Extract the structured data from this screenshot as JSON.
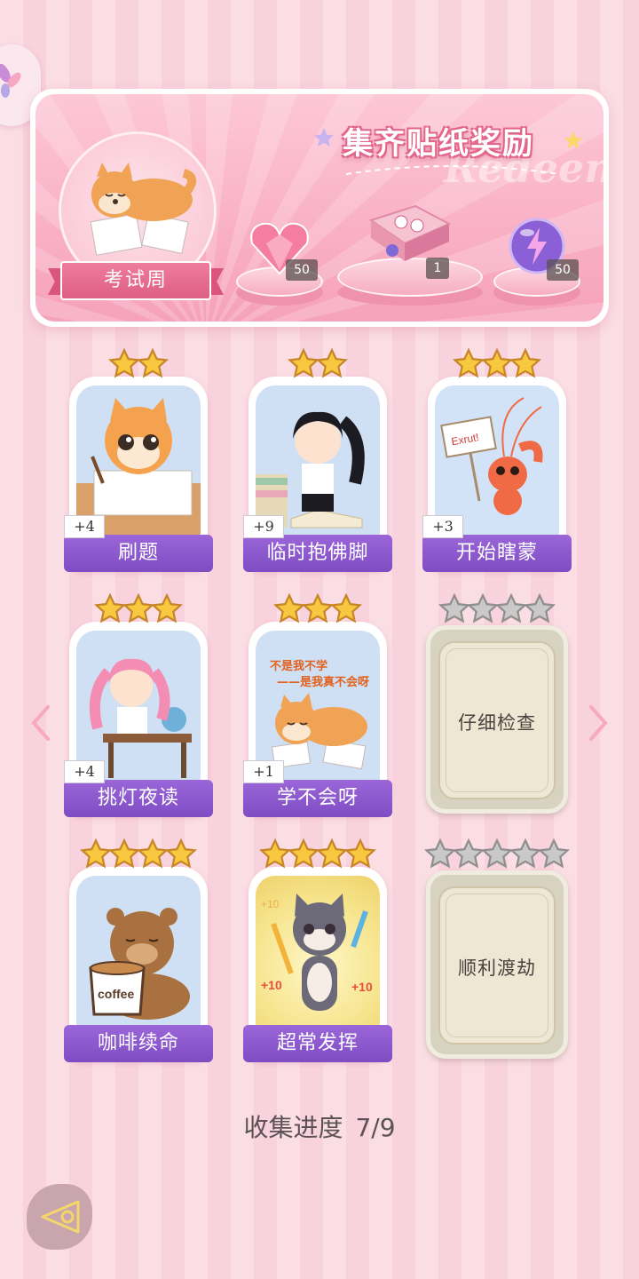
{
  "banner": {
    "title": "集齐贴纸奖励",
    "watermark": "Redeem",
    "theme_label": "考试周",
    "rewards": [
      {
        "name": "pink-heart-gem",
        "count": "50"
      },
      {
        "name": "stationery-gift-box",
        "count": "1"
      },
      {
        "name": "purple-energy-orb",
        "count": "50"
      }
    ]
  },
  "stickers": [
    {
      "label": "刷题",
      "stars": 2,
      "bonus": "+4",
      "collected": true,
      "art": "cat-writing-icon"
    },
    {
      "label": "临时抱佛脚",
      "stars": 2,
      "bonus": "+9",
      "collected": true,
      "art": "girl-reading-icon"
    },
    {
      "label": "开始瞎蒙",
      "stars": 3,
      "bonus": "+3",
      "collected": true,
      "art": "lobster-sign-icon",
      "sign_text": "Exrut!"
    },
    {
      "label": "挑灯夜读",
      "stars": 3,
      "bonus": "+4",
      "collected": true,
      "art": "pink-girl-desk-icon"
    },
    {
      "label": "学不会呀",
      "stars": 3,
      "bonus": "+1",
      "collected": true,
      "art": "shiba-crying-icon",
      "caption_line1": "不是我不学",
      "caption_line2": "——是我真不会呀"
    },
    {
      "label": "仔细检查",
      "stars": 4,
      "collected": false
    },
    {
      "label": "咖啡续命",
      "stars": 4,
      "collected": true,
      "art": "bear-coffee-icon",
      "cup_text": "coffee"
    },
    {
      "label": "超常发挥",
      "stars": 4,
      "collected": true,
      "art": "cat-pencil-icon",
      "plus_texts": [
        "+10",
        "+10",
        "+10"
      ]
    },
    {
      "label": "顺利渡劫",
      "stars": 5,
      "collected": false
    }
  ],
  "progress": {
    "label": "收集进度",
    "value": "7/9"
  },
  "colors": {
    "label_bar": "#8a57cc",
    "star_gold": "#f7c840",
    "star_grey": "#c9c9c9",
    "background": "#fbdde4"
  }
}
